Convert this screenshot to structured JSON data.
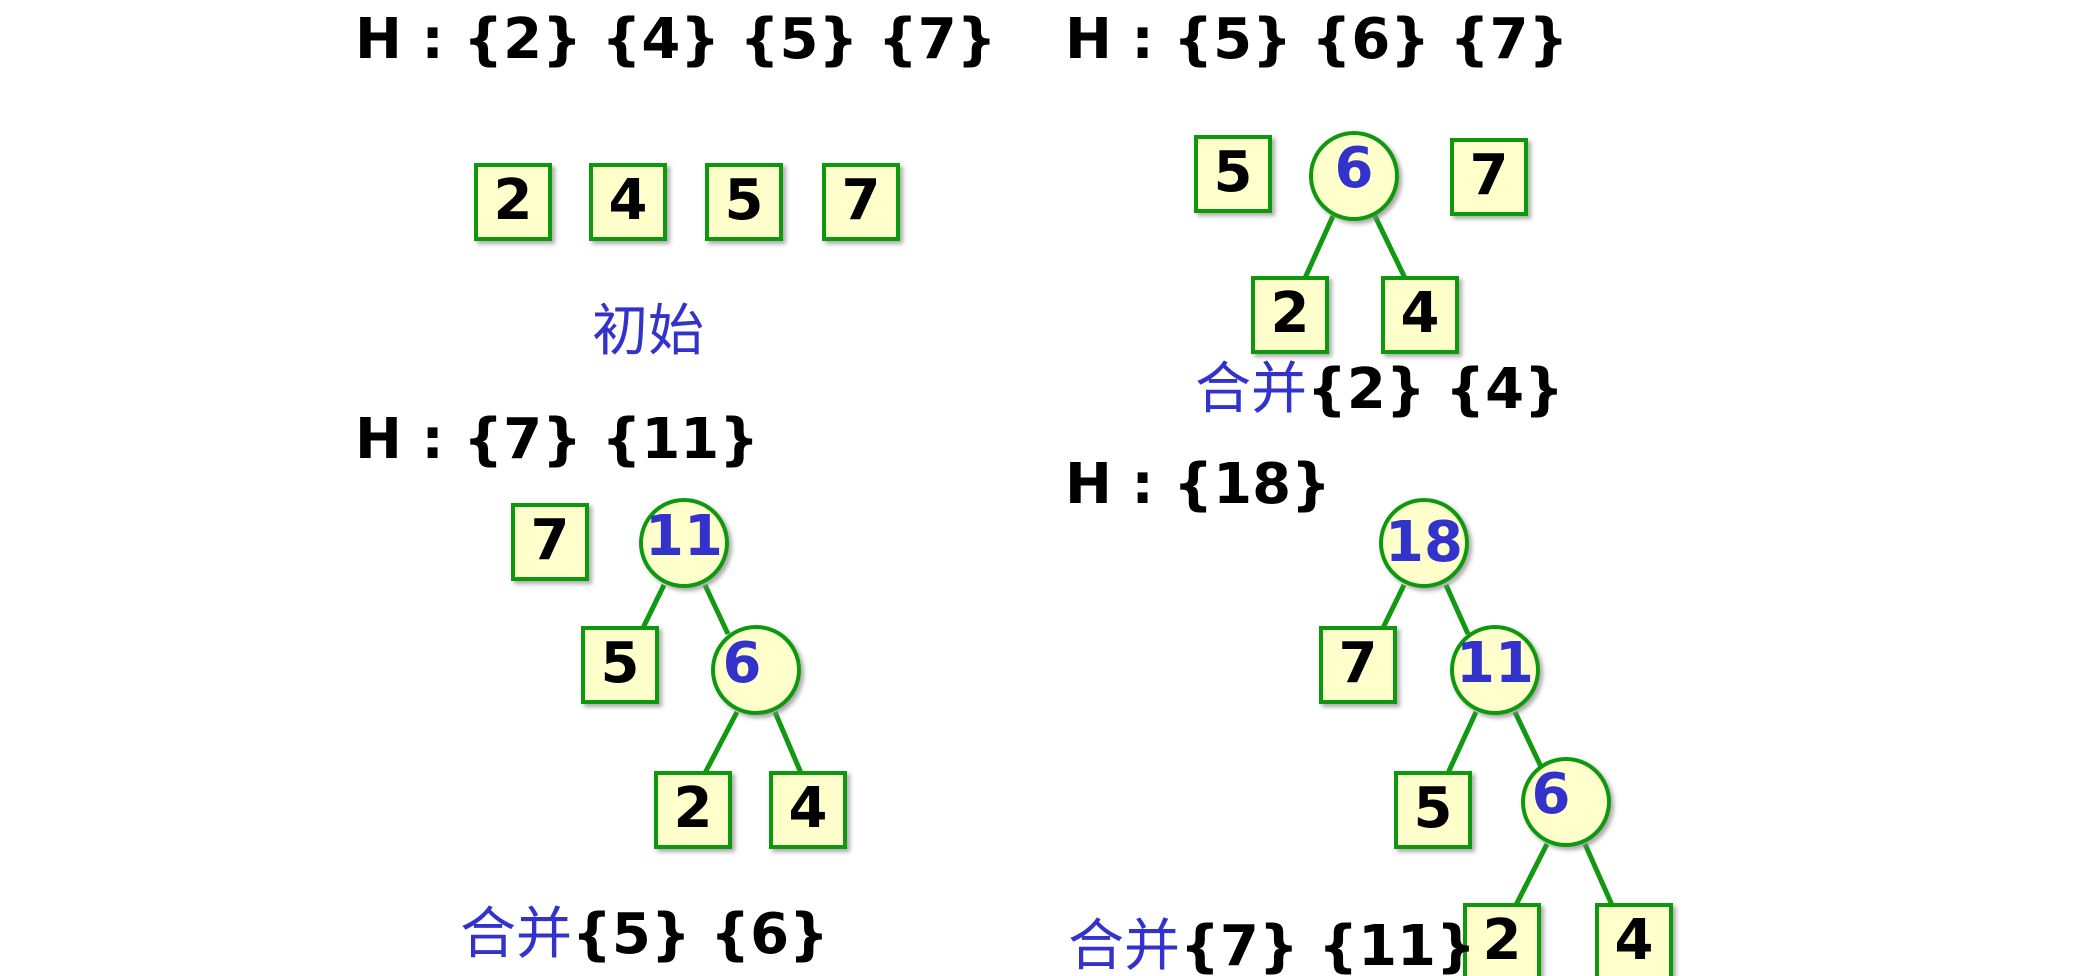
{
  "panels": [
    {
      "heading": "H : {2} {4} {5} {7}",
      "caption": {
        "cn": "初始",
        "sets": ""
      }
    },
    {
      "heading": "H : {5} {6} {7}",
      "caption": {
        "cn": "合并",
        "sets": "{2} {4}"
      }
    },
    {
      "heading": "H : {7} {11}",
      "caption": {
        "cn": "合并",
        "sets": "{5} {6}"
      }
    },
    {
      "heading": "H : {18}",
      "caption": {
        "cn": "合并",
        "sets": "{7} {11}"
      }
    }
  ],
  "nodes": {
    "p1_l2": "2",
    "p1_l4": "4",
    "p1_l5": "5",
    "p1_l7": "7",
    "p2_l5": "5",
    "p2_n6": "6",
    "p2_l7": "7",
    "p2_l2": "2",
    "p2_l4": "4",
    "p3_l7": "7",
    "p3_n11": "11",
    "p3_l5": "5",
    "p3_n6": "6",
    "p3_l2": "2",
    "p3_l4": "4",
    "p4_n18": "18",
    "p4_l7": "7",
    "p4_n11": "11",
    "p4_l5": "5",
    "p4_n6": "6",
    "p4_l2": "2",
    "p4_l4": "4"
  },
  "colors": {
    "leaf_fill": "#ffffcc",
    "border": "#119911",
    "internal_text": "#3333cc",
    "caption_cn": "#3333cc",
    "text": "#000000"
  }
}
